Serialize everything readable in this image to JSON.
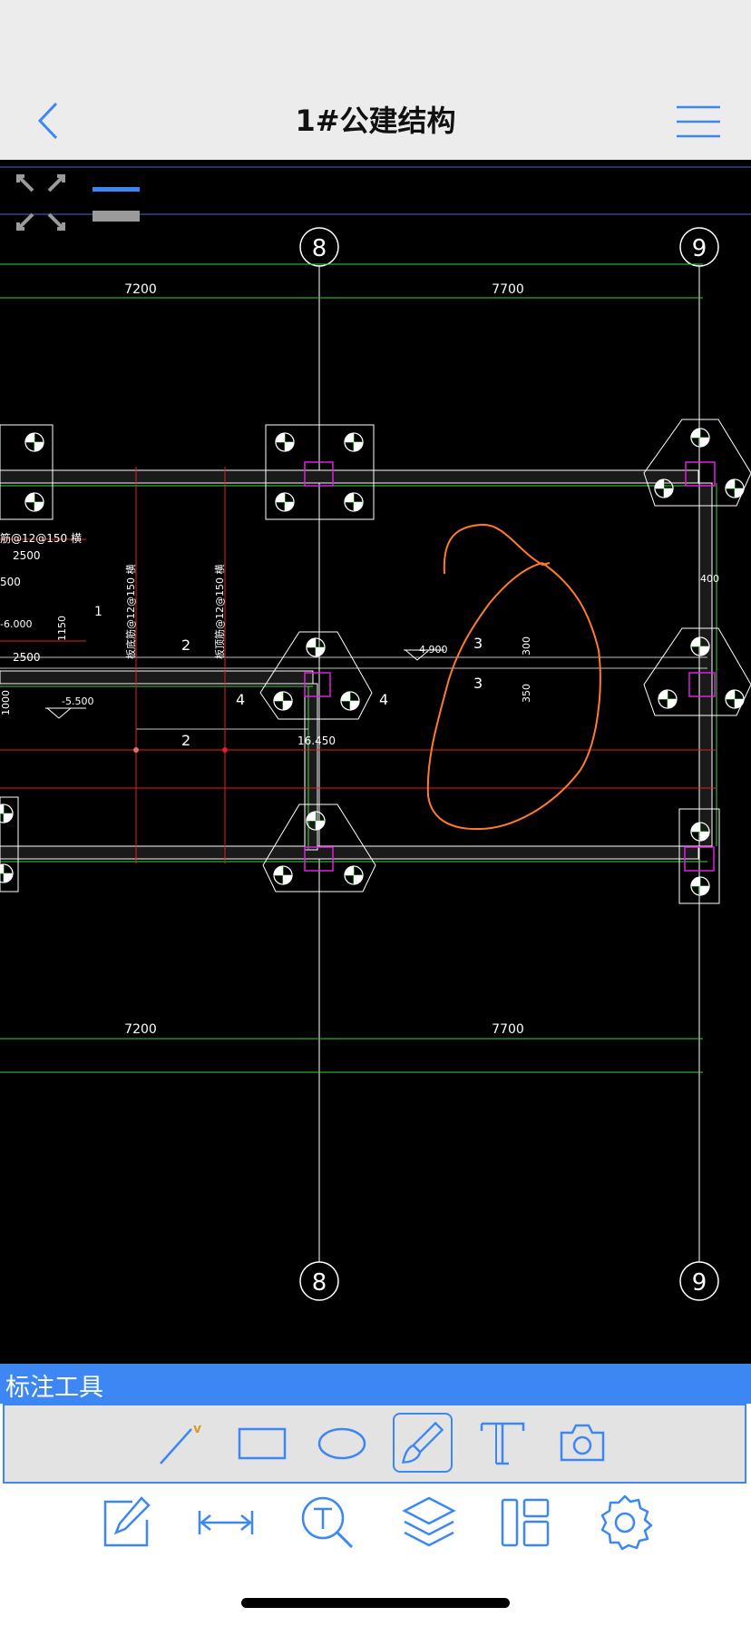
{
  "navbar": {
    "title": "1#公建结构",
    "back_icon": "chevron-left-icon",
    "menu_icon": "hamburger-menu-icon"
  },
  "canvas": {
    "axis_labels": [
      "8",
      "9",
      "8",
      "9"
    ],
    "dimensions": [
      "7200",
      "7700",
      "7200",
      "7700"
    ],
    "annotations": [
      "筋@12@150 横",
      "2500",
      "500",
      "1",
      "-6.000",
      "1150",
      "2500",
      "1000",
      "-5.500",
      "板底筋@12@150 横",
      "板顶筋@12@150 横",
      "2",
      "4",
      "4",
      "2",
      "-4.900",
      "3",
      "3",
      "300",
      "350",
      "16.450",
      "400"
    ],
    "colors": {
      "background": "#000000",
      "grid": "#ffffff",
      "dimension": "#3fd23f",
      "red_line": "#e02020",
      "markup": "#ff7b2c",
      "column": "#e020e0"
    }
  },
  "toolbar": {
    "header_label": "标注工具",
    "tools": [
      "line-tool-icon",
      "rectangle-tool-icon",
      "ellipse-tool-icon",
      "brush-tool-icon",
      "text-tool-icon",
      "camera-tool-icon"
    ],
    "active_tool": "brush-tool-icon"
  },
  "bottom_bar": [
    "edit-icon",
    "measure-icon",
    "text-search-icon",
    "layers-icon",
    "layout-icon",
    "settings-icon"
  ],
  "colors": {
    "accent": "#3d87f5",
    "nav_bg": "#ececec"
  }
}
